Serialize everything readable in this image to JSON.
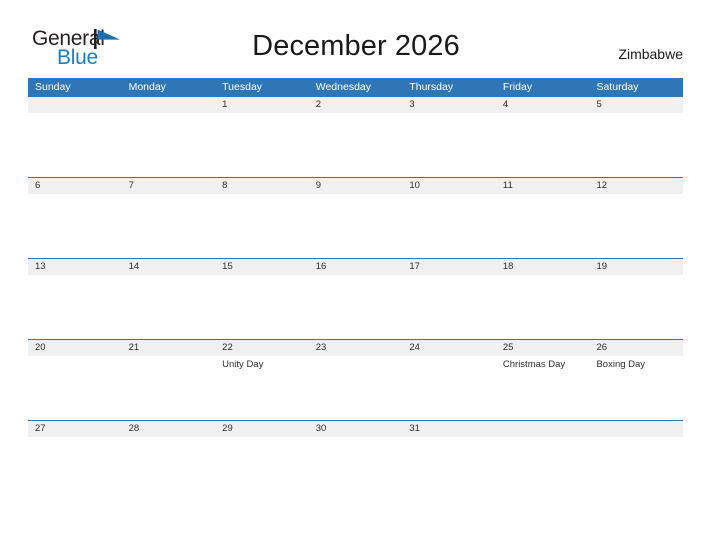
{
  "brand": {
    "name_part1": "General",
    "name_part2": "Blue",
    "flag_icon": "flag-triangle-icon",
    "accent_color": "#1b7fc4"
  },
  "header": {
    "title": "December 2026",
    "country": "Zimbabwe"
  },
  "theme": {
    "header_blue": "#2f76b6",
    "band_gray": "#f0f0f0",
    "text_color": "#2d2d2d",
    "page_background": "#ffffff"
  },
  "calendar": {
    "month": "December",
    "year": "2026",
    "weekday_headers": [
      "Sunday",
      "Monday",
      "Tuesday",
      "Wednesday",
      "Thursday",
      "Friday",
      "Saturday"
    ],
    "weeks": [
      [
        {
          "date": "",
          "event": ""
        },
        {
          "date": "",
          "event": ""
        },
        {
          "date": "1",
          "event": ""
        },
        {
          "date": "2",
          "event": ""
        },
        {
          "date": "3",
          "event": ""
        },
        {
          "date": "4",
          "event": ""
        },
        {
          "date": "5",
          "event": ""
        }
      ],
      [
        {
          "date": "6",
          "event": ""
        },
        {
          "date": "7",
          "event": ""
        },
        {
          "date": "8",
          "event": ""
        },
        {
          "date": "9",
          "event": ""
        },
        {
          "date": "10",
          "event": ""
        },
        {
          "date": "11",
          "event": ""
        },
        {
          "date": "12",
          "event": ""
        }
      ],
      [
        {
          "date": "13",
          "event": ""
        },
        {
          "date": "14",
          "event": ""
        },
        {
          "date": "15",
          "event": ""
        },
        {
          "date": "16",
          "event": ""
        },
        {
          "date": "17",
          "event": ""
        },
        {
          "date": "18",
          "event": ""
        },
        {
          "date": "19",
          "event": ""
        }
      ],
      [
        {
          "date": "20",
          "event": ""
        },
        {
          "date": "21",
          "event": ""
        },
        {
          "date": "22",
          "event": "Unity Day"
        },
        {
          "date": "23",
          "event": ""
        },
        {
          "date": "24",
          "event": ""
        },
        {
          "date": "25",
          "event": "Christmas Day"
        },
        {
          "date": "26",
          "event": "Boxing Day"
        }
      ],
      [
        {
          "date": "27",
          "event": ""
        },
        {
          "date": "28",
          "event": ""
        },
        {
          "date": "29",
          "event": ""
        },
        {
          "date": "30",
          "event": ""
        },
        {
          "date": "31",
          "event": ""
        },
        {
          "date": "",
          "event": ""
        },
        {
          "date": "",
          "event": ""
        }
      ]
    ]
  }
}
